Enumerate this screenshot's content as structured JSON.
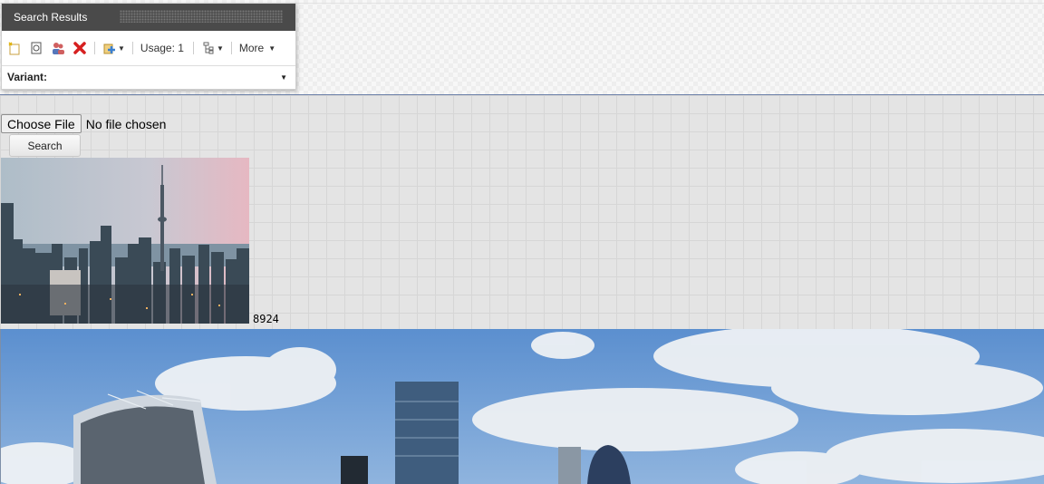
{
  "panel": {
    "title": "Search Results",
    "toolbar": {
      "usage_label": "Usage: 1",
      "more_label": "More"
    },
    "variant_label": "Variant:"
  },
  "upload": {
    "choose_label": "Choose File",
    "file_status": "No file chosen",
    "search_label": "Search"
  },
  "result": {
    "image_id": "8924"
  },
  "colors": {
    "panel_header": "#4a4a4a",
    "delete_red": "#d62020"
  }
}
